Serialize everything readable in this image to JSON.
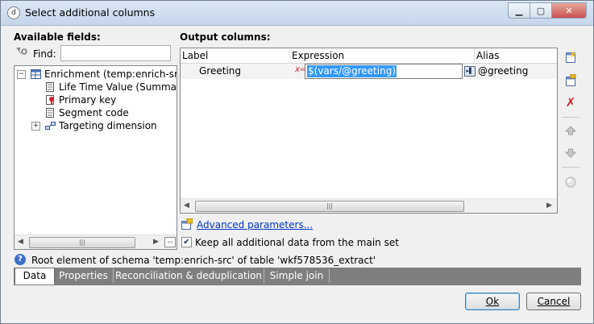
{
  "window": {
    "title": "Select additional columns",
    "icon": "app-icon"
  },
  "available_fields": {
    "label": "Available fields:",
    "find_label": "Find:",
    "find_value": "",
    "tree": [
      {
        "label": "Enrichment (temp:enrich-src)",
        "icon": "table-icon",
        "expander": "−"
      },
      {
        "label": "Life Time Value (Summary o",
        "icon": "field-icon"
      },
      {
        "label": "Primary key",
        "icon": "key-icon"
      },
      {
        "label": "Segment code",
        "icon": "field-icon"
      },
      {
        "label": "Targeting dimension",
        "icon": "link-icon",
        "expander": "+"
      }
    ]
  },
  "output_columns": {
    "label": "Output columns:",
    "headers": [
      "Label",
      "Expression",
      "Alias"
    ],
    "rows": [
      {
        "label": "Greeting",
        "expression": "$(vars/@greeting)",
        "alias": "@greeting"
      }
    ]
  },
  "side_toolbar": {
    "icons": [
      "add-column-icon",
      "edit-column-icon",
      "delete-icon",
      "move-up-icon",
      "move-down-icon",
      "distribute-icon"
    ]
  },
  "advanced": {
    "link": "Advanced parameters...",
    "keep_checkbox_label": "Keep all additional data from the main set",
    "keep_checked": true
  },
  "status": {
    "text": "Root element of schema 'temp:enrich-src' of table 'wkf578536_extract'"
  },
  "tabs": [
    {
      "label": "Data",
      "active": true
    },
    {
      "label": "Properties",
      "active": false
    },
    {
      "label": "Reconciliation & deduplication",
      "active": false
    },
    {
      "label": "Simple join",
      "active": false
    }
  ],
  "buttons": {
    "ok": "Ok",
    "cancel": "Cancel"
  },
  "colors": {
    "selection": "#3399ff",
    "link": "#0033cc",
    "tabstrip": "#7f7f7f"
  }
}
